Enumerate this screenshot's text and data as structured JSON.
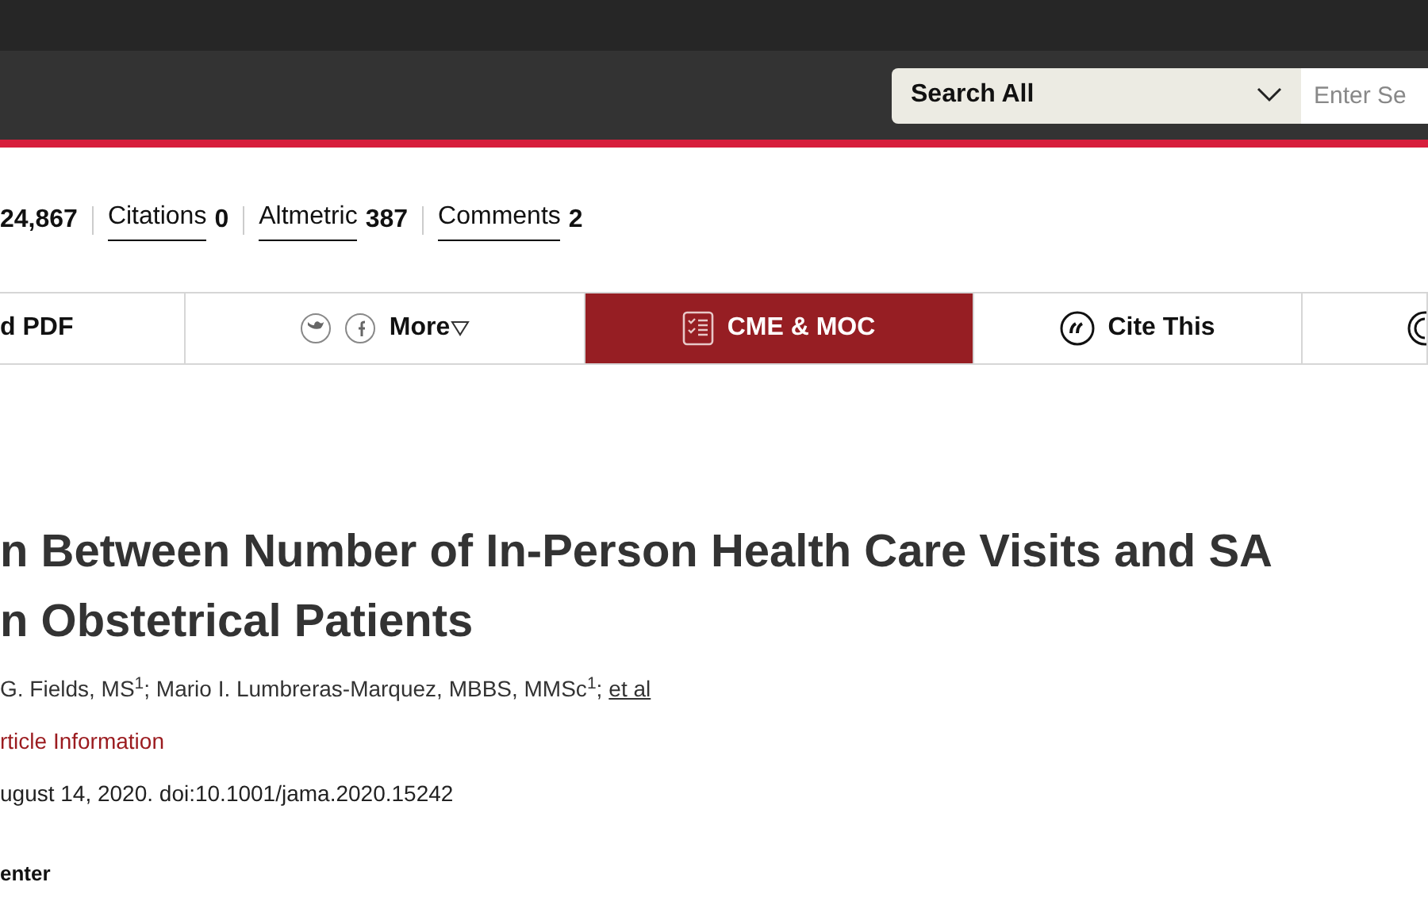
{
  "header": {
    "search_scope": "Search All",
    "search_placeholder": "Enter Se"
  },
  "metrics": [
    {
      "value": "24,867"
    },
    {
      "label": "Citations",
      "value": "0"
    },
    {
      "label": "Altmetric",
      "value": "387"
    },
    {
      "label": "Comments",
      "value": "2"
    }
  ],
  "toolbar": [
    {
      "kind": "text",
      "label": "d PDF",
      "selected": false
    },
    {
      "kind": "share",
      "label": "More",
      "selected": false
    },
    {
      "kind": "cme",
      "label": "CME & MOC",
      "selected": true
    },
    {
      "kind": "cite",
      "label": "Cite This",
      "selected": false
    },
    {
      "kind": "partial",
      "selected": false
    }
  ],
  "article": {
    "title_lines": [
      "n Between Number of In-Person Health Care Visits and SA",
      "n Obstetrical Patients"
    ],
    "authors": "G. Fields, MS$^{1}$; Mario I. Lumbreras-Marquez, MBBS, MMSc$^{1}$;",
    "authors_link": "et al",
    "info_link": "rticle Information",
    "published": "ugust 14, 2020. doi:10.1001/jama.2020.15242",
    "section": "enter"
  }
}
